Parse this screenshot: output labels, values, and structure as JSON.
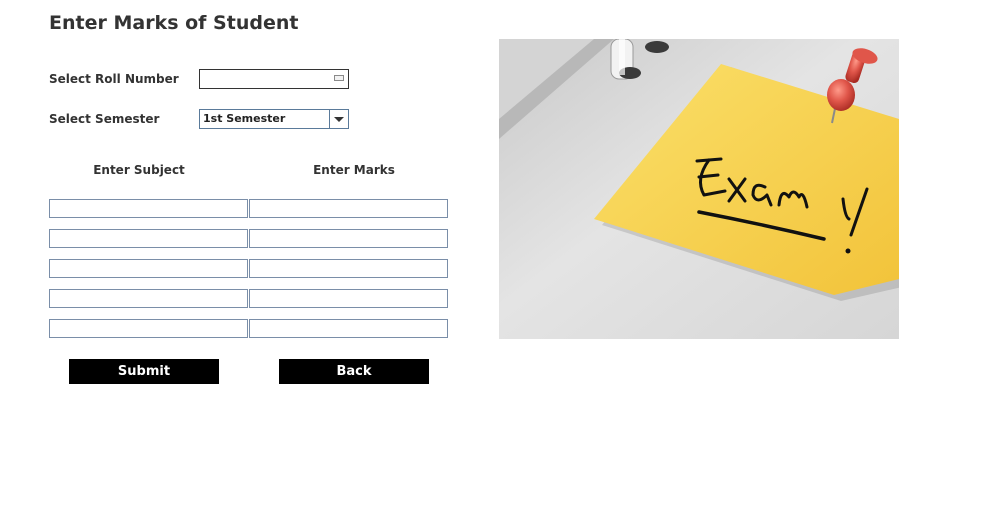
{
  "page": {
    "title": "Enter Marks of Student"
  },
  "form": {
    "roll_label": "Select Roll Number",
    "roll_value": "",
    "semester_label": "Select Semester",
    "semester_value": "1st Semester",
    "subject_header": "Enter Subject",
    "marks_header": "Enter Marks",
    "rows": [
      {
        "subject": "",
        "marks": ""
      },
      {
        "subject": "",
        "marks": ""
      },
      {
        "subject": "",
        "marks": ""
      },
      {
        "subject": "",
        "marks": ""
      },
      {
        "subject": "",
        "marks": ""
      }
    ],
    "submit_label": "Submit",
    "back_label": "Back"
  },
  "illustration": {
    "note_text": "Exam!",
    "note_color": "#f8d44c",
    "pin_color": "#e0564a"
  }
}
